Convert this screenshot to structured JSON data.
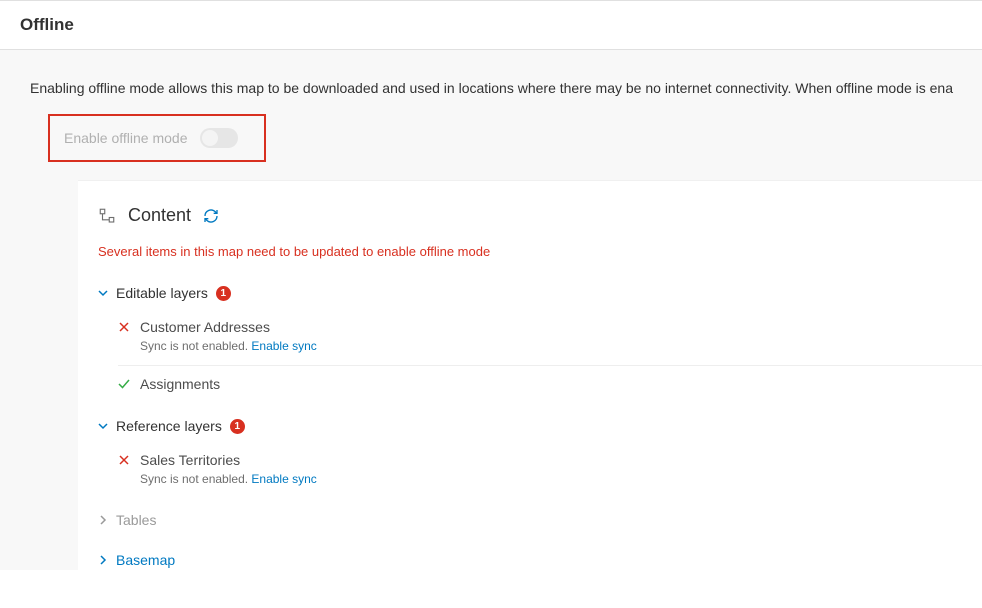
{
  "header": {
    "title": "Offline"
  },
  "description": "Enabling offline mode allows this map to be downloaded and used in locations where there may be no internet connectivity. When offline mode is ena",
  "enable": {
    "label": "Enable offline mode",
    "state": "off",
    "disabled": true
  },
  "content": {
    "title": "Content",
    "warning": "Several items in this map need to be updated to enable offline mode",
    "sections": {
      "editable": {
        "label": "Editable layers",
        "badge": "1",
        "expanded": true,
        "items": [
          {
            "name": "Customer Addresses",
            "status": "error",
            "sub_text": "Sync is not enabled. ",
            "sub_link": "Enable sync"
          },
          {
            "name": "Assignments",
            "status": "ok"
          }
        ]
      },
      "reference": {
        "label": "Reference layers",
        "badge": "1",
        "expanded": true,
        "items": [
          {
            "name": "Sales Territories",
            "status": "error",
            "sub_text": "Sync is not enabled. ",
            "sub_link": "Enable sync"
          }
        ]
      },
      "tables": {
        "label": "Tables",
        "expanded": false
      },
      "basemap": {
        "label": "Basemap",
        "expanded": false
      }
    }
  }
}
